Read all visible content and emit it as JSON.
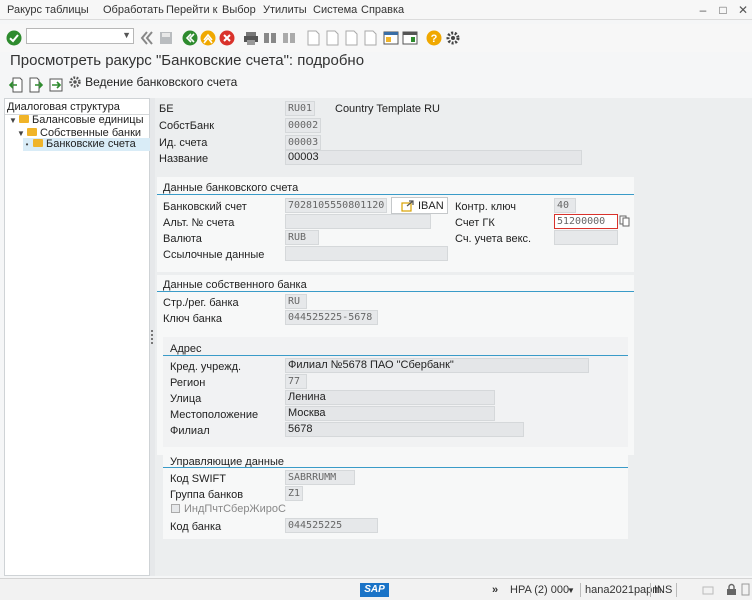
{
  "menu": [
    "Ракурс таблицы",
    "Обработать",
    "Перейти к",
    "Выбор",
    "Утилиты",
    "Система",
    "Справка"
  ],
  "title": "Просмотреть ракурс \"Банковские счета\": подробно",
  "app_toolbar": {
    "maintain_label": "Ведение банковского счета"
  },
  "tree": {
    "header": "Диалоговая структура",
    "items": [
      "Балансовые единицы",
      "Собственные банки",
      "Банковские счета"
    ]
  },
  "header_fields": {
    "be_label": "БЕ",
    "be_value": "RU01",
    "be_desc": "Country Template RU",
    "bank_label": "СобстБанк",
    "bank_value": "00002",
    "acct_id_label": "Ид. счета",
    "acct_id_value": "00003",
    "name_label": "Название",
    "name_value": "00003"
  },
  "bank_account": {
    "title": "Данные банковского счета",
    "account_label": "Банковский счет",
    "account_value": "7028105550801120.",
    "iban_label": "IBAN",
    "ctrl_key_label": "Контр. ключ",
    "ctrl_key_value": "40",
    "alt_label": "Альт. № счета",
    "alt_value": "",
    "gl_label": "Счет ГК",
    "gl_value": "51200000",
    "currency_label": "Валюта",
    "currency_value": "RUB",
    "bill_label": "Сч. учета векс.",
    "bill_value": "",
    "ref_label": "Ссылочные данные",
    "ref_value": ""
  },
  "own_bank": {
    "title": "Данные собственного банка",
    "country_label": "Стр./рег. банка",
    "country_value": "RU",
    "key_label": "Ключ банка",
    "key_value": "044525225-5678"
  },
  "address": {
    "title": "Адрес",
    "inst_label": "Кред. учрежд.",
    "inst_value": "Филиал №5678 ПАО \"Сбербанк\"",
    "region_label": "Регион",
    "region_value": "77",
    "street_label": "Улица",
    "street_value": "Ленина",
    "city_label": "Местоположение",
    "city_value": "Москва",
    "branch_label": "Филиал",
    "branch_value": "5678"
  },
  "control": {
    "title": "Управляющие данные",
    "swift_label": "Код SWIFT",
    "swift_value": "SABRRUMM",
    "group_label": "Группа банков",
    "group_value": "Z1",
    "checkbox_label": "ИндПчтСберЖироС",
    "code_label": "Код банка",
    "code_value": "044525225"
  },
  "status": {
    "logo": "SAP",
    "system": "HPA (2) 000",
    "server": "hana2021papm",
    "mode": "INS"
  },
  "colors": {
    "accent": "#3a9bc8",
    "ok": "#2e8b2e",
    "orange": "#f0a800",
    "red": "#d9322b"
  }
}
